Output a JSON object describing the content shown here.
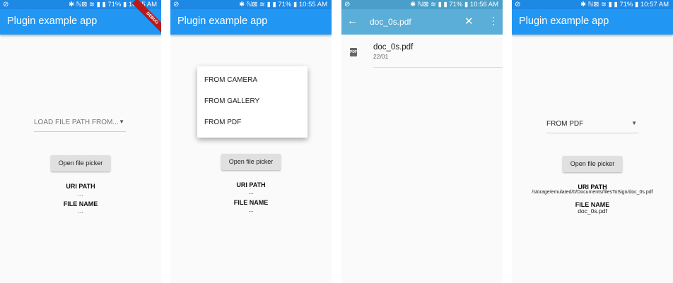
{
  "status_bar": {
    "icons": "✱ ℕ⊠ ≋ ▮ ▮",
    "battery": "71%",
    "times": [
      "10:55 AM",
      "10:55 AM",
      "10:56 AM",
      "10:57 AM"
    ]
  },
  "app_title": "Plugin example app",
  "debug_banner": "DEBUG",
  "screen1": {
    "dropdown_value": "LOAD FILE PATH FROM...",
    "button": "Open file picker",
    "uri_label": "URI PATH",
    "uri_value": "...",
    "name_label": "FILE NAME",
    "name_value": "..."
  },
  "screen2": {
    "menu_items": [
      "FROM CAMERA",
      "FROM GALLERY",
      "FROM PDF"
    ],
    "button": "Open file picker",
    "uri_label": "URI PATH",
    "uri_value": "...",
    "name_label": "FILE NAME",
    "name_value": "..."
  },
  "screen3": {
    "search_query": "doc_0s.pdf",
    "file_name": "doc_0s.pdf",
    "file_date": "22/01"
  },
  "screen4": {
    "dropdown_value": "FROM PDF",
    "button": "Open file picker",
    "uri_label": "URI PATH",
    "uri_value": "/storage/emulated/0/Documents/filesToSign/doc_0s.pdf",
    "name_label": "FILE NAME",
    "name_value": "doc_0s.pdf"
  },
  "colors": {
    "appbar": "#2196f3",
    "status": "#1e88e5",
    "search_bar": "#5aaed7"
  }
}
